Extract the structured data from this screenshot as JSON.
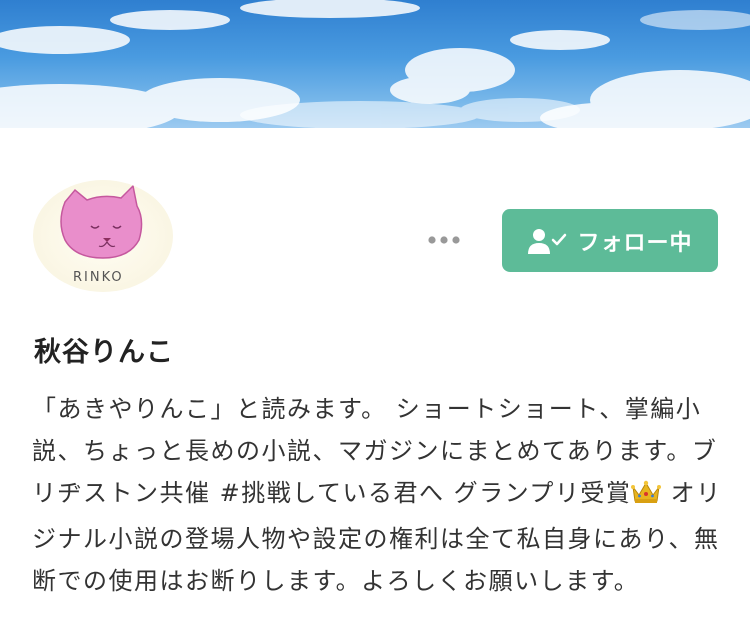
{
  "cover": {
    "icon": "sky-clouds-cover-image"
  },
  "avatar": {
    "icon": "pink-cat-avatar",
    "text": "RINKO"
  },
  "actions": {
    "more_icon": "more-dots-icon",
    "follow_label": "フォロー中",
    "follow_icon": "user-check-icon",
    "follow_color": "#5dbb98"
  },
  "profile": {
    "name": "秋谷りんこ",
    "bio_part1": "「あきやりんこ」と読みます。 ショートショート、掌編小説、ちょっと長めの小説、マガジンにまとめてあります。ブリヂストン共催 #挑戦している君へ グランプリ受賞",
    "bio_crown_icon": "crown-icon",
    "bio_part2": " オリジナル小説の登場人物や設定の権利は全て私自身にあり、無断での使用はお断りします。よろしくお願いします。"
  }
}
